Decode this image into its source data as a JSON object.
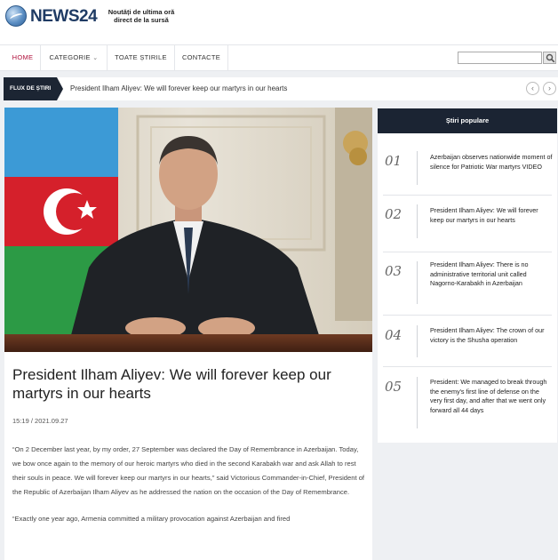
{
  "header": {
    "logo": "NEWS24",
    "tagline": "Noutăți de ultima oră direct de la sursă"
  },
  "nav": {
    "items": [
      "HOME",
      "CATEGORIE",
      "TOATE ȘTIRILE",
      "CONTACTE"
    ],
    "search_placeholder": ""
  },
  "ticker": {
    "label": "FLUX DE ȘTIRI",
    "headline": "President Ilham Aliyev: We will forever keep our martyrs in our hearts"
  },
  "article": {
    "title": "President Ilham Aliyev: We will forever keep our martyrs in our hearts",
    "date": "15:19 / 2021.09.27",
    "paragraphs": [
      "“On 2 December last year, by my order, 27 September was declared the Day of Remembrance in Azerbaijan. Today, we bow once again to the memory of our heroic martyrs who died in the second Karabakh war and ask Allah to rest their souls in peace. We will forever keep our martyrs in our hearts,” said Victorious Commander-in-Chief, President of the Republic of Azerbaijan Ilham Aliyev as he addressed the nation on the occasion of the Day of Remembrance.",
      "“Exactly one year ago, Armenia committed a military provocation against Azerbaijan and fired"
    ]
  },
  "sidebar": {
    "title": "Știri populare",
    "items": [
      {
        "num": "01",
        "text": "Azerbaijan observes nationwide moment of silence for Patriotic War martyrs VIDEO"
      },
      {
        "num": "02",
        "text": "President Ilham Aliyev: We will forever keep our martyrs in our hearts"
      },
      {
        "num": "03",
        "text": "President Ilham Aliyev: There is no administrative territorial unit called Nagorno-Karabakh in Azerbaijan"
      },
      {
        "num": "04",
        "text": "President Ilham Aliyev: The crown of our victory is the Shusha operation"
      },
      {
        "num": "05",
        "text": "President: We managed to break through the enemy's first line of defense on the very first day, and after that we went only forward all 44 days"
      }
    ]
  },
  "colors": {
    "accent": "#b1123d",
    "dark": "#1c2533"
  }
}
